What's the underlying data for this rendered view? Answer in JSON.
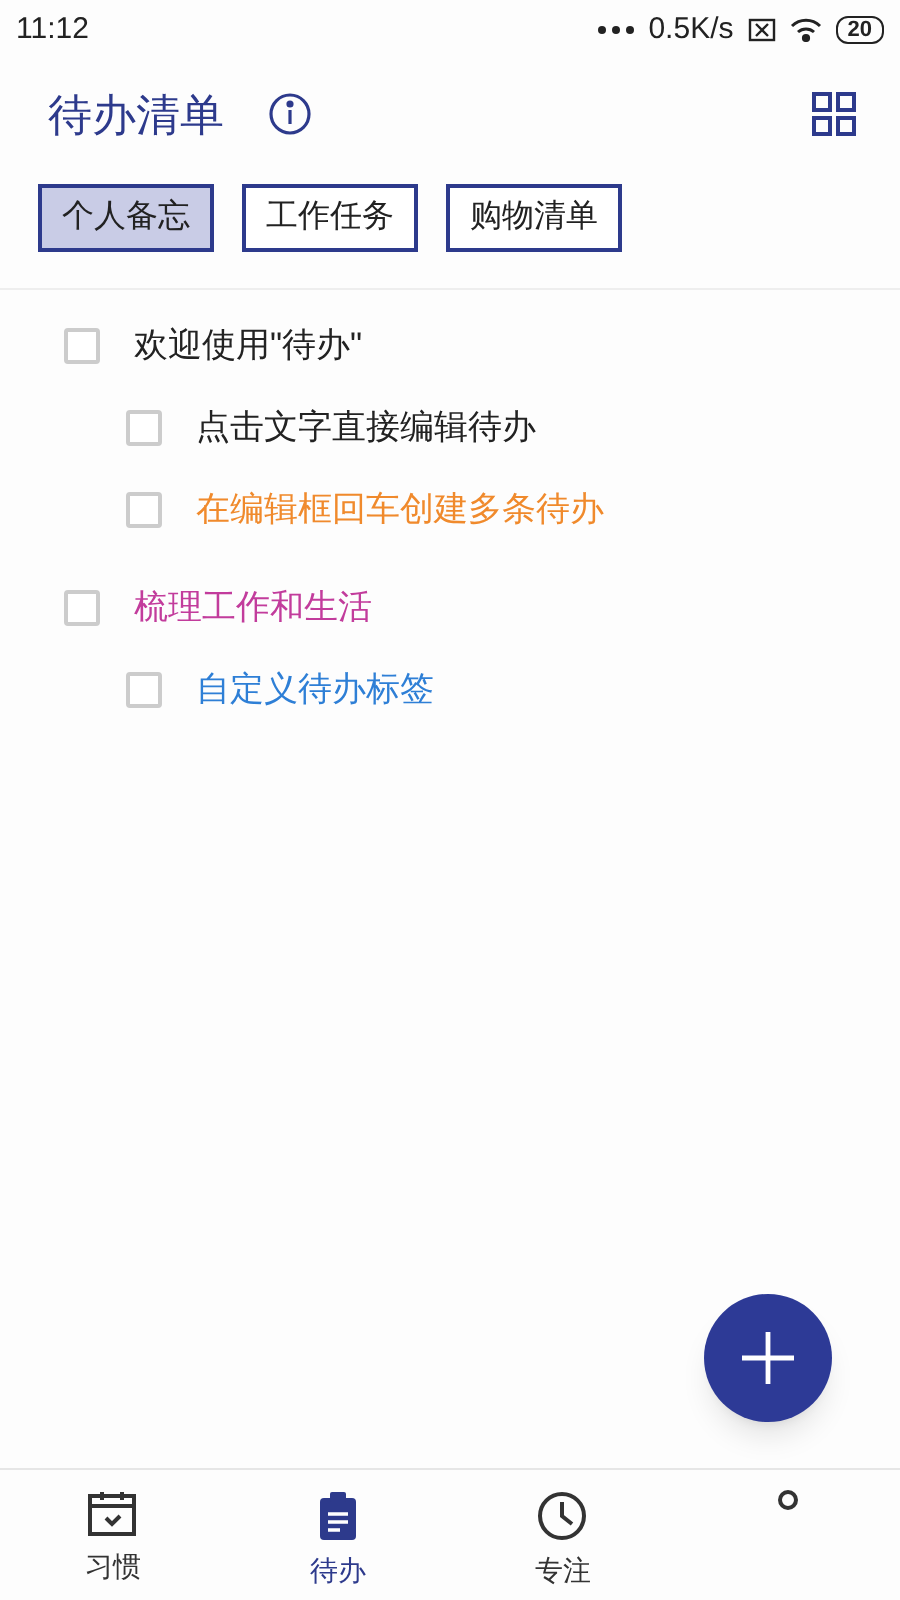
{
  "status_bar": {
    "time": "11:12",
    "speed": "0.5K/s",
    "battery": "20"
  },
  "header": {
    "title": "待办清单"
  },
  "lists": [
    {
      "label": "个人备忘",
      "selected": true
    },
    {
      "label": "工作任务",
      "selected": false
    },
    {
      "label": "购物清单",
      "selected": false
    }
  ],
  "todos": [
    {
      "text": "欢迎使用\"待办\"",
      "checked": false,
      "color": "#222222",
      "children": [
        {
          "text": "点击文字直接编辑待办",
          "checked": false,
          "color": "#222222"
        },
        {
          "text": "在编辑框回车创建多条待办",
          "checked": false,
          "color": "#f08a2c"
        }
      ]
    },
    {
      "text": "梳理工作和生活",
      "checked": false,
      "color": "#c23c9c",
      "children": [
        {
          "text": "自定义待办标签",
          "checked": false,
          "color": "#2e7fd6"
        }
      ]
    }
  ],
  "nav": [
    {
      "kind": "habit",
      "label": "习惯",
      "selected": false
    },
    {
      "kind": "todo",
      "label": "待办",
      "selected": true
    },
    {
      "kind": "focus",
      "label": "专注",
      "selected": false
    },
    {
      "kind": "me",
      "selected": false
    }
  ]
}
